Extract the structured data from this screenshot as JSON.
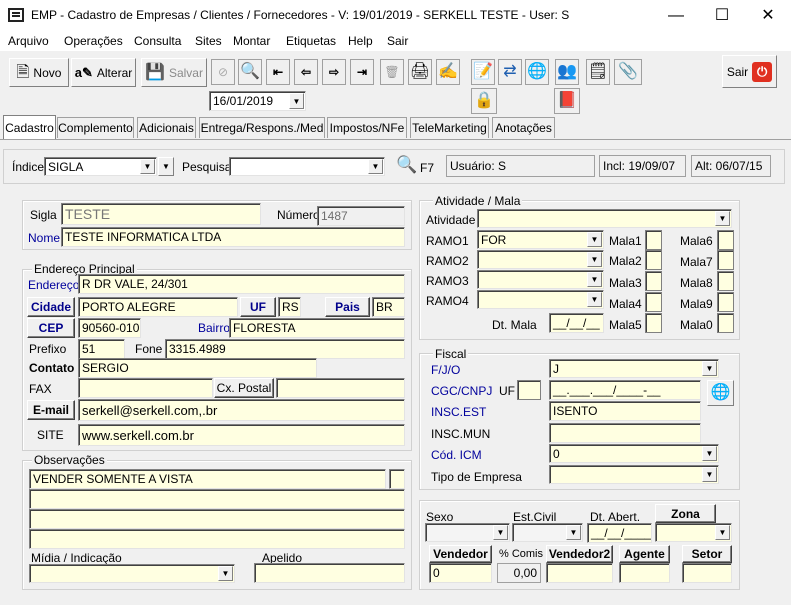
{
  "window": {
    "title": "EMP - Cadastro de Empresas / Clientes / Fornecedores - V: 19/01/2019 - SERKELL TESTE - User: S"
  },
  "menu": [
    "Arquivo",
    "Operações",
    "Consulta",
    "Sites",
    "Montar",
    "Etiquetas",
    "Help",
    "Sair"
  ],
  "toolbar": {
    "novo": "Novo",
    "alterar": "Alterar",
    "salvar": "Salvar",
    "sair": "Sair",
    "date": "16/01/2019"
  },
  "tabs": [
    "Cadastro",
    "Complemento",
    "Adicionais",
    "Entrega/Respons./Med",
    "Impostos/NFe",
    "TeleMarketing",
    "Anotações"
  ],
  "search": {
    "indice_label": "Índice",
    "indice_value": "SIGLA",
    "pesquisa_label": "Pesquisa",
    "f7": "F7",
    "usuario": "Usuário: S",
    "incl": "Incl: 19/09/07",
    "alt": "Alt: 06/07/15"
  },
  "ident": {
    "sigla_label": "Sigla",
    "sigla": "TESTE",
    "numero_label": "Número",
    "numero": "1487",
    "nome_label": "Nome",
    "nome": "TESTE INFORMATICA LTDA"
  },
  "endereco": {
    "title": "Endereço Principal",
    "endereco_label": "Endereço",
    "endereco": "R DR VALE, 24/301",
    "cidade_btn": "Cidade",
    "cidade": "PORTO ALEGRE",
    "uf_btn": "UF",
    "uf": "RS",
    "pais_btn": "Pais",
    "pais": "BR",
    "cep_btn": "CEP",
    "cep": "90560-010",
    "bairro_label": "Bairro",
    "bairro": "FLORESTA",
    "prefixo_label": "Prefixo",
    "prefixo": "51",
    "fone_label": "Fone",
    "fone": "3315.4989",
    "contato_label": "Contato",
    "contato": "SERGIO",
    "fax_label": "FAX",
    "fax": "",
    "cxpostal_label": "Cx. Postal",
    "cxpostal": "",
    "email_btn": "E-mail",
    "email": "serkell@serkell.com,.br",
    "site_label": "SITE",
    "site": "www.serkell.com.br"
  },
  "obs": {
    "title": "Observações",
    "lines": [
      "VENDER SOMENTE A VISTA",
      "",
      "",
      ""
    ],
    "midia_label": "Mídia / Indicação",
    "apelido_label": "Apelido"
  },
  "atividade": {
    "title": "Atividade / Mala",
    "atividade_label": "Atividade",
    "ramos": [
      {
        "label": "RAMO1",
        "value": "FOR"
      },
      {
        "label": "RAMO2",
        "value": ""
      },
      {
        "label": "RAMO3",
        "value": ""
      },
      {
        "label": "RAMO4",
        "value": ""
      }
    ],
    "dtmala_label": "Dt. Mala",
    "dtmala": "__/__/__",
    "malas_left": [
      "Mala1",
      "Mala2",
      "Mala3",
      "Mala4",
      "Mala5"
    ],
    "malas_right": [
      "Mala6",
      "Mala7",
      "Mala8",
      "Mala9",
      "Mala0"
    ]
  },
  "fiscal": {
    "title": "Fiscal",
    "fjo_label": "F/J/O",
    "fjo": "J",
    "cgc_label": "CGC/CNPJ",
    "uf_label": "UF",
    "cgc": "__.___.___/____-__",
    "inscest_label": "INSC.EST",
    "inscest": "ISENTO",
    "inscmun_label": "INSC.MUN",
    "inscmun": "",
    "codicm_label": "Cód. ICM",
    "codicm": "0",
    "tipo_label": "Tipo de Empresa"
  },
  "bottom": {
    "sexo_label": "Sexo",
    "estcivil_label": "Est.Civil",
    "dtabert_label": "Dt. Abert.",
    "dtabert": "__/__/____",
    "zona_btn": "Zona",
    "vendedor_btn": "Vendedor",
    "vendedor": "0",
    "comis_label": "% Comis",
    "comis": "0,00",
    "vendedor2_btn": "Vendedor2",
    "agente_btn": "Agente",
    "setor_btn": "Setor"
  }
}
